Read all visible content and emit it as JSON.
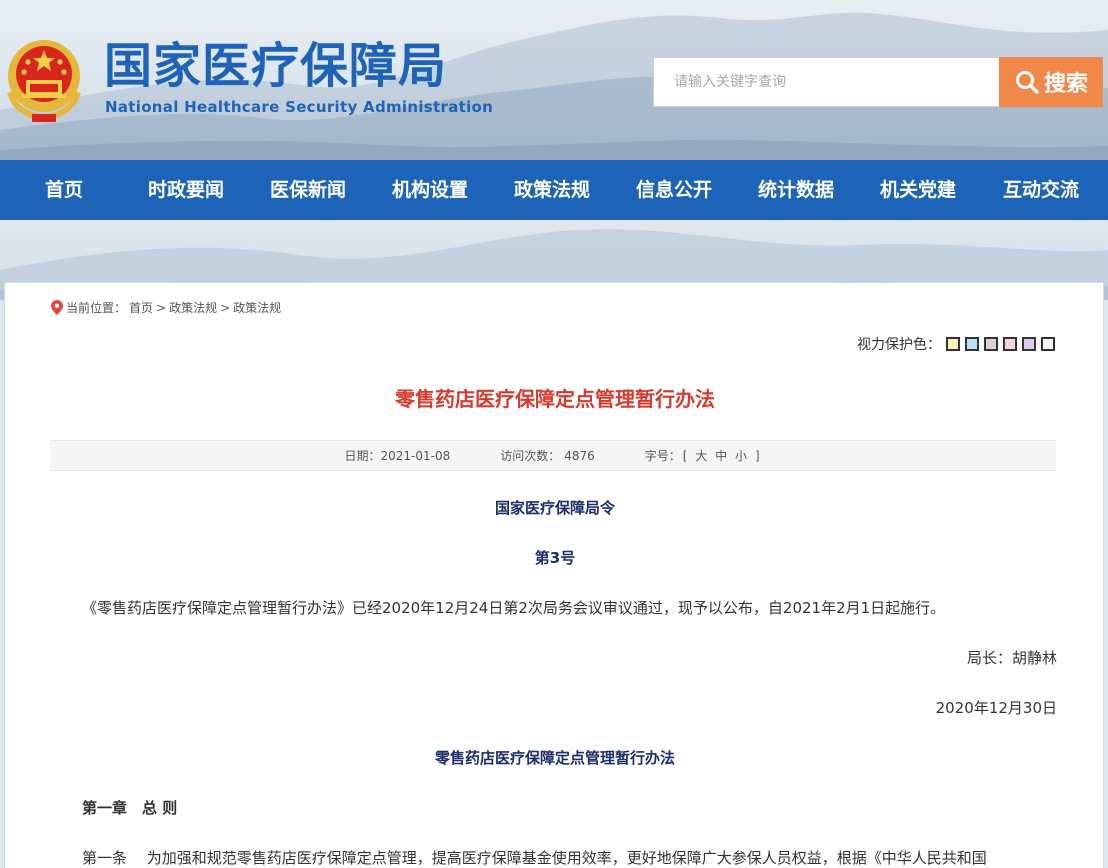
{
  "header": {
    "title": "国家医疗保障局",
    "subtitle": "National Healthcare Security Administration",
    "search_placeholder": "请输入关键字查询",
    "search_label": "搜索",
    "search_icon": "magnifier-icon",
    "emblem": "national-emblem"
  },
  "nav": {
    "items": [
      {
        "label": "首页"
      },
      {
        "label": "时政要闻"
      },
      {
        "label": "医保新闻"
      },
      {
        "label": "机构设置"
      },
      {
        "label": "政策法规"
      },
      {
        "label": "信息公开"
      },
      {
        "label": "统计数据"
      },
      {
        "label": "机关党建"
      },
      {
        "label": "互动交流"
      }
    ]
  },
  "breadcrumb": {
    "prefix": "当前位置：",
    "items": [
      "首页",
      "政策法规",
      "政策法规"
    ],
    "separator": ">",
    "icon": "location-pin-icon"
  },
  "eye_protect": {
    "label": "视力保护色：",
    "swatches": [
      "#fbf2b6",
      "#b7e4f5",
      "#d5d5d5",
      "#f4d4dd",
      "#ddc9f1",
      "#ffffff"
    ]
  },
  "article": {
    "title": "零售药店医疗保障定点管理暂行办法",
    "meta": {
      "date_label": "日期：",
      "date": "2021-01-08",
      "visits_label": "访问次数：",
      "visits": "4876",
      "font_label": "字号：",
      "font_sizes_open": "[",
      "font_sizes": [
        "大",
        "中",
        "小"
      ],
      "font_sizes_close": "]"
    },
    "order_heading": "国家医疗保障局令",
    "order_number": "第3号",
    "intro": "《零售药店医疗保障定点管理暂行办法》已经2020年12月24日第2次局务会议审议通过，现予以公布，自2021年2月1日起施行。",
    "signature": "局长：胡静林",
    "sign_date": "2020年12月30日",
    "doc_title": "零售药店医疗保障定点管理暂行办法",
    "chapter1": "第一章　总 则",
    "article1": "第一条　 为加强和规范零售药店医疗保障定点管理，提高医疗保障基金使用效率，更好地保障广大参保人员权益，根据《中华人民共和国"
  },
  "colors": {
    "brand_blue": "#1d63b8",
    "search_orange": "#f0884a",
    "title_red": "#d53a2f",
    "heading_navy": "#1a2f6b"
  }
}
